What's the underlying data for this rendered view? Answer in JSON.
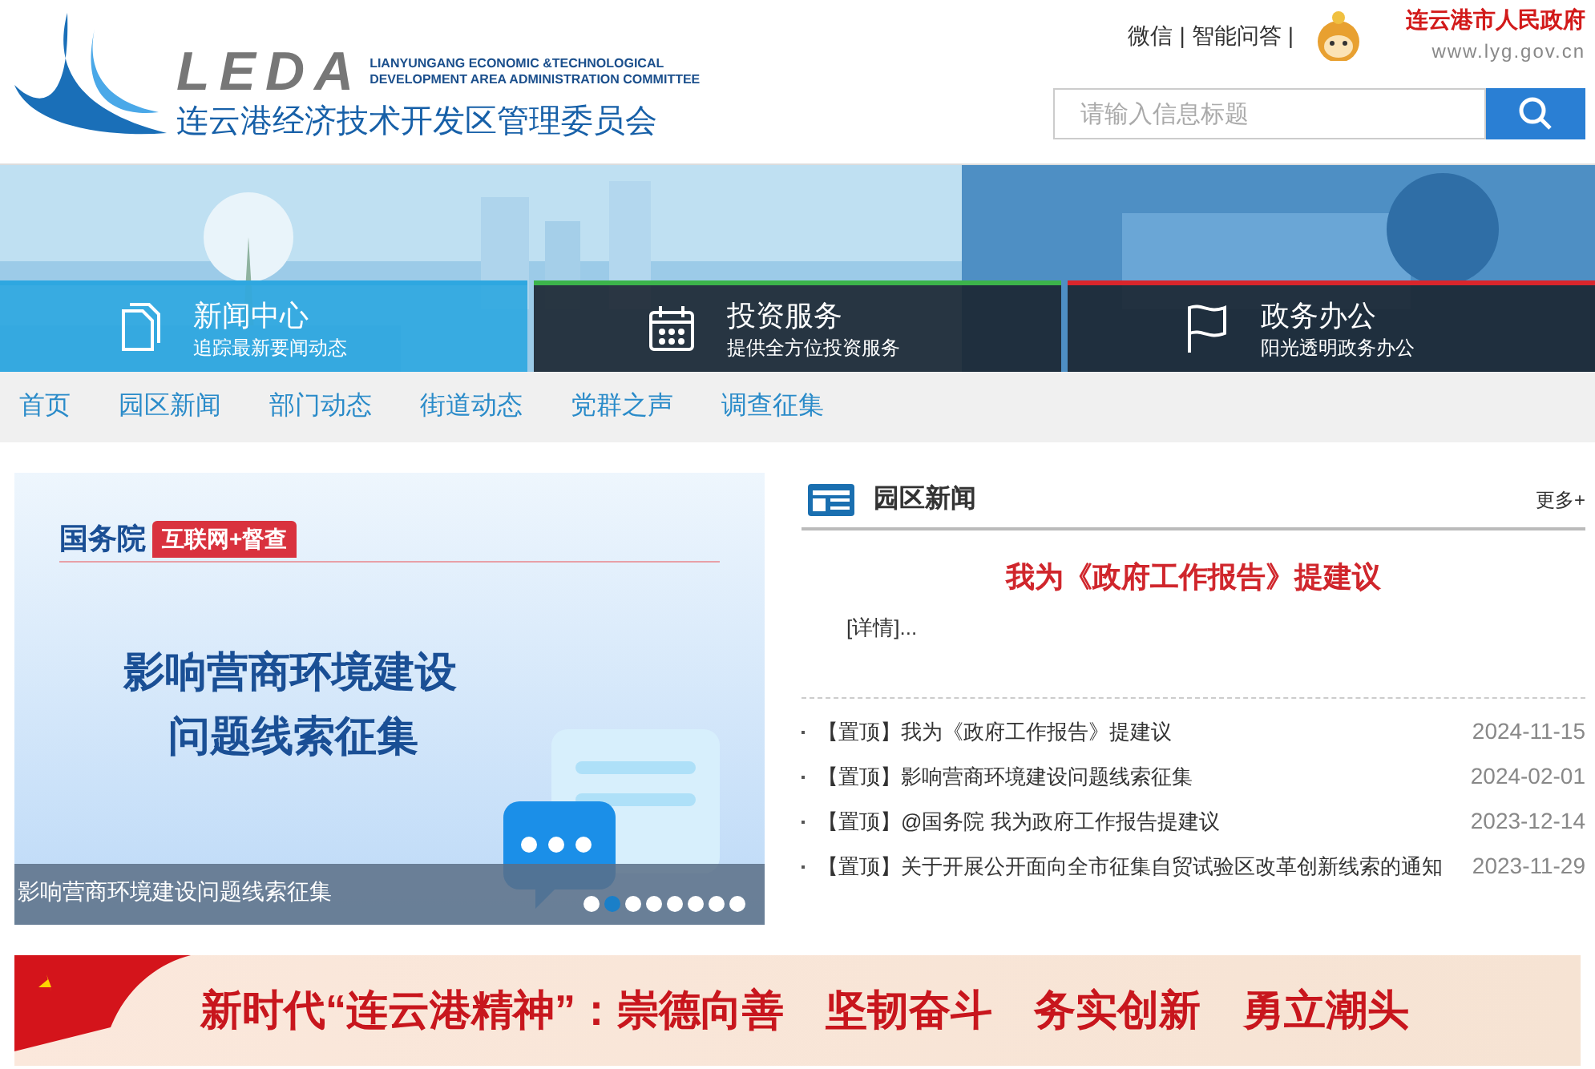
{
  "header": {
    "logo_mark": "LEDA",
    "logo_en_1": "LIANYUNGANG ECONOMIC &TECHNOLOGICAL",
    "logo_en_2": "DEVELOPMENT AREA ADMINISTRATION COMMITTEE",
    "logo_cn": "连云港经济技术开发区管理委员会",
    "links": [
      "微信",
      "智能问答"
    ],
    "separator": "|",
    "gov_name": "连云港市人民政府",
    "gov_url": "www.lyg.gov.cn",
    "search": {
      "placeholder": "请输入信息标题"
    }
  },
  "tiles": [
    {
      "title": "新闻中心",
      "subtitle": "追踪最新要闻动态",
      "kind": "document",
      "selected": true,
      "color": "#2ea7e0"
    },
    {
      "title": "投资服务",
      "subtitle": "提供全方位投资服务",
      "kind": "calendar",
      "selected": false,
      "color": "#3cb44b"
    },
    {
      "title": "政务办公",
      "subtitle": "阳光透明政务办公",
      "kind": "flag",
      "selected": false,
      "color": "#d9262c"
    }
  ],
  "nav": [
    "首页",
    "园区新闻",
    "部门动态",
    "街道动态",
    "党群之声",
    "调查征集"
  ],
  "slider": {
    "tag_left": "国务院",
    "tag_right": "互联网+督查",
    "headline_1": "影响营商环境建设",
    "headline_2": "问题线索征集",
    "caption": "影响营商环境建设问题线索征集",
    "dots": [
      {
        "selected": false
      },
      {
        "selected": true
      },
      {
        "selected": false
      },
      {
        "selected": false
      },
      {
        "selected": false
      },
      {
        "selected": false
      },
      {
        "selected": false
      },
      {
        "selected": false
      }
    ]
  },
  "news": {
    "title": "园区新闻",
    "more": "更多+",
    "featured_title": "我为《政府工作报告》提建议",
    "featured_link": "[详情]...",
    "items": [
      {
        "tag": "【置顶】",
        "title": "我为《政府工作报告》提建议",
        "date": "2024-11-15"
      },
      {
        "tag": "【置顶】",
        "title": "影响营商环境建设问题线索征集",
        "date": "2024-02-01"
      },
      {
        "tag": "【置顶】",
        "title": "@国务院 我为政府工作报告提建议",
        "date": "2023-12-14"
      },
      {
        "tag": "【置顶】",
        "title": "关于开展公开面向全市征集自贸试验区改革创新线索的通知",
        "date": "2023-11-29"
      }
    ]
  },
  "banner": {
    "text": "新时代“连云港精神”：崇德向善　坚韧奋斗　务实创新　勇立潮头"
  }
}
